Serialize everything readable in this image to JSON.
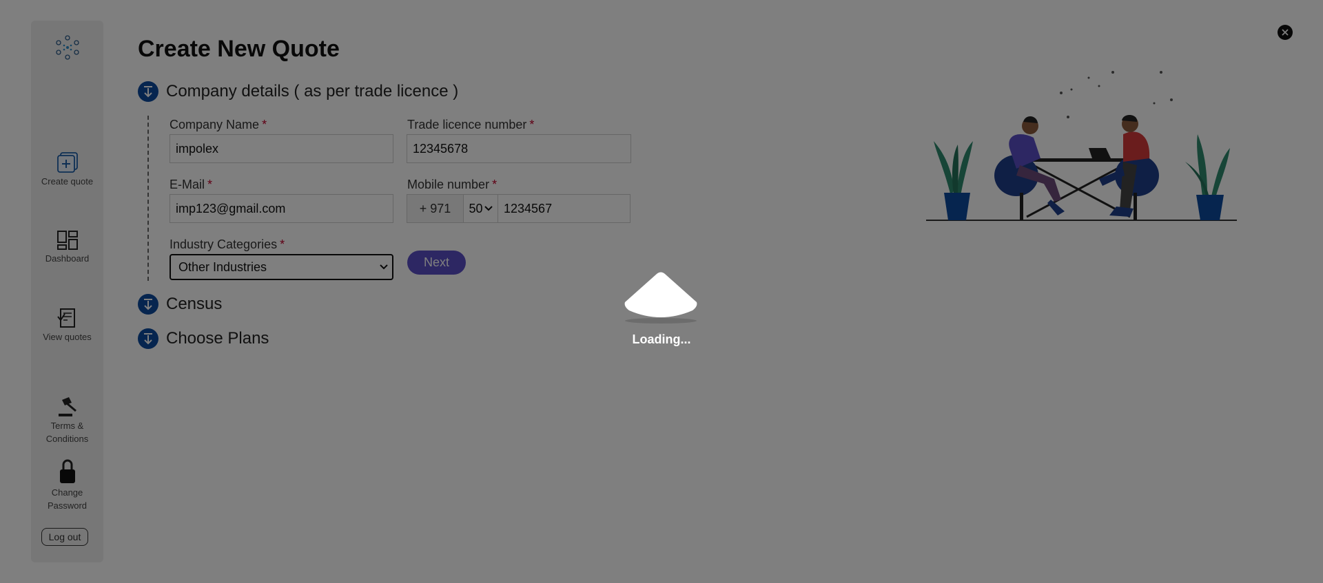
{
  "sidebar": {
    "items": [
      {
        "label": "Create quote",
        "icon": "plus-square-icon"
      },
      {
        "label": "Dashboard",
        "icon": "dashboard-icon"
      },
      {
        "label": "View quotes",
        "icon": "document-check-icon"
      },
      {
        "label": "Terms & Conditions",
        "icon": "gavel-icon"
      },
      {
        "label": "Change Password",
        "icon": "lock-icon"
      }
    ],
    "logout_label": "Log out"
  },
  "page": {
    "title": "Create New Quote"
  },
  "steps": [
    {
      "label": "Company details ( as per trade licence )"
    },
    {
      "label": "Census"
    },
    {
      "label": "Choose Plans"
    }
  ],
  "form": {
    "company_name": {
      "label": "Company Name",
      "required": "*",
      "value": "impolex"
    },
    "trade_licence": {
      "label": "Trade licence number",
      "required": "*",
      "value": "12345678"
    },
    "email": {
      "label": "E-Mail",
      "required": "*",
      "value": "imp123@gmail.com"
    },
    "mobile": {
      "label": "Mobile number",
      "required": "*",
      "country_code": "+ 971",
      "area_code": "50",
      "value": "1234567"
    },
    "industry": {
      "label": "Industry Categories",
      "required": "*",
      "value": "Other Industries"
    },
    "next_label": "Next"
  },
  "loader": {
    "text": "Loading..."
  },
  "colors": {
    "accent": "#0d4a9e",
    "button": "#5b4fc6",
    "required": "#c0002a"
  }
}
